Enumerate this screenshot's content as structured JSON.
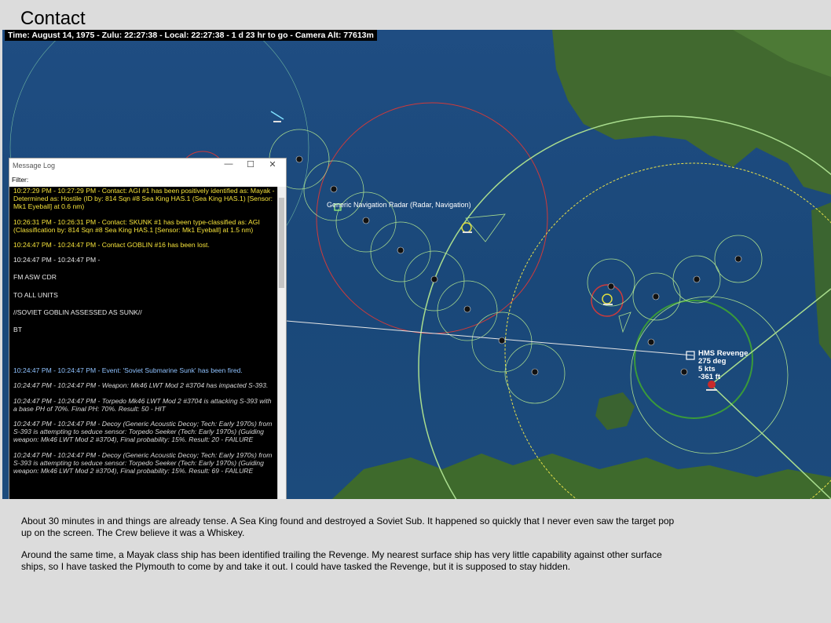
{
  "page": {
    "title": "Contact"
  },
  "statusbar": {
    "text": "Time: August 14, 1975 - Zulu: 22:27:38 - Local: 22:27:38 - 1 d 23 hr to go -  Camera Alt: 77613m"
  },
  "map": {
    "radar_label": "Generic Navigation Radar (Radar, Navigation)",
    "unit": {
      "name": "HMS Revenge",
      "course": "275 deg",
      "speed": "5 kts",
      "depth": "-361 ft"
    },
    "colors": {
      "land": "#3f6a2e",
      "ocean": "#1d4a7e",
      "range_red": "#d03a3a",
      "range_green": "#9fd88a",
      "range_yellow": "#e8e04a"
    }
  },
  "message_log": {
    "title": "Message Log",
    "filter_label": "Filter:",
    "controls": {
      "minimize": "—",
      "maximize": "☐",
      "close": "✕"
    },
    "entries": [
      {
        "style": "yellow",
        "text": "10:27:29 PM - 10:27:29 PM - Contact: AGI #1 has been positively identified as: Mayak - Determined as: Hostile (ID by: 814 Sqn #8 Sea King HAS.1 (Sea King HAS.1) [Sensor: Mk1 Eyeball] at 0.6 nm)"
      },
      {
        "style": "yellow",
        "text": "10:26:31 PM - 10:26:31 PM - Contact: SKUNK #1 has been type-classified as: AGI (Classification by: 814 Sqn #8 Sea King HAS.1 [Sensor: Mk1 Eyeball] at 1.5 nm)"
      },
      {
        "style": "yellow",
        "text": "10:24:47 PM - 10:24:47 PM - Contact GOBLIN #16 has been lost."
      },
      {
        "style": "white",
        "text": "10:24:47 PM - 10:24:47 PM -"
      },
      {
        "style": "white",
        "text": "FM ASW CDR"
      },
      {
        "style": "white",
        "text": "TO ALL UNITS"
      },
      {
        "style": "white",
        "text": "//SOVIET GOBLIN ASSESSED AS SUNK//"
      },
      {
        "style": "white",
        "text": "BT"
      },
      {
        "style": "blue",
        "text": "10:24:47 PM - 10:24:47 PM - Event: 'Soviet Submarine Sunk' has been fired."
      },
      {
        "style": "ital",
        "text": "10:24:47 PM - 10:24:47 PM - Weapon: Mk46 LWT Mod 2 #3704 has impacted S-393."
      },
      {
        "style": "ital",
        "text": "10:24:47 PM - 10:24:47 PM - Torpedo Mk46 LWT Mod 2 #3704 is attacking S-393 with a base PH of 70%. Final PH: 70%. Result: 50 - HIT"
      },
      {
        "style": "ital",
        "text": "10:24:47 PM - 10:24:47 PM - Decoy (Generic Acoustic Decoy; Tech: Early 1970s) from S-393 is attempting to seduce sensor: Torpedo Seeker (Tech: Early 1970s) (Guiding weapon: Mk46 LWT Mod 2 #3704), Final probability: 15%. Result: 20 - FAILURE"
      },
      {
        "style": "ital",
        "text": "10:24:47 PM - 10:24:47 PM - Decoy (Generic Acoustic Decoy; Tech: Early 1970s) from S-393 is attempting to seduce sensor: Torpedo Seeker (Tech: Early 1970s) (Guiding weapon: Mk46 LWT Mod 2 #3704), Final probability: 15%. Result: 69 - FAILURE"
      }
    ]
  },
  "caption": {
    "paragraph1": "About 30 minutes in and things are already tense.  A Sea King found and destroyed a Soviet Sub.  It happened so quickly that I never even saw the target pop up on the screen.  The Crew believe it was a Whiskey.",
    "paragraph2": "Around the same time, a Mayak class ship has been identified trailing the Revenge.  My nearest surface ship has very little capability against other surface ships, so I have tasked the Plymouth to come by and take it out.  I could have tasked the Revenge, but it is supposed to stay hidden."
  }
}
